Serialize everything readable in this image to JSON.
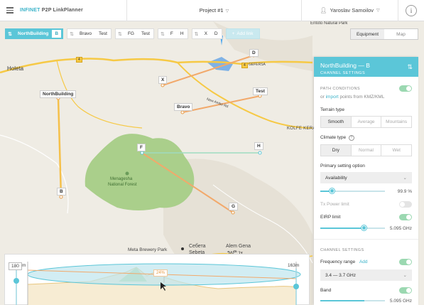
{
  "header": {
    "brand_part1": "INFINET",
    "brand_part2": "P2P LinkPlanner",
    "project": "Project #1",
    "user": "Yaroslav Samoilov",
    "info_label": "i"
  },
  "links": [
    {
      "a": "NorthBuilding",
      "b": "B",
      "active": true
    },
    {
      "a": "Bravo",
      "b": "Test"
    },
    {
      "a": "FG",
      "b": "Test"
    },
    {
      "a": "F",
      "b": "H"
    },
    {
      "a": "X",
      "b": "D"
    }
  ],
  "add_link": "Add link",
  "view_toggle": {
    "equipment": "Equipment",
    "map": "Map"
  },
  "map": {
    "sites": {
      "north": "NorthBuilding",
      "b": "B",
      "x": "X",
      "d": "D",
      "bravo": "Bravo",
      "test": "Test",
      "f": "F",
      "h": "H",
      "g": "G"
    },
    "places": {
      "holeta": "Holeta",
      "entoto": "Entoto Natural Park",
      "gefersa": "GEFERSA",
      "kolfe": "KOLFE KERA",
      "new_ambo": "New Ambo Rd",
      "menagesha1": "Menagesha",
      "menagesha2": "National Forest",
      "meta": "Meta Brewery Park",
      "alem": "Alem Gena",
      "alem2": "ዓለም ገና",
      "sebeta": "Sebeta",
      "sebeta2": "Себета"
    },
    "roads": {
      "r1": "4",
      "r2": "4"
    }
  },
  "panel": {
    "title": "NorthBuilding — B",
    "subtitle": "CHANNEL SETTINGS",
    "path_conditions": "PATH CONDITIONS",
    "or_text": "or",
    "import_link": "import",
    "import_rest": "points from KMZ/KML",
    "terrain_label": "Terrain type",
    "terrain_options": [
      "Smooth",
      "Average",
      "Mountains"
    ],
    "climate_label": "Climate type",
    "climate_help": "?",
    "climate_options": [
      "Dry",
      "Normal",
      "Wet"
    ],
    "primary_label": "Primary setting option",
    "primary_value": "Availability",
    "availability_value": "99.9 %",
    "availability_fraction": 0.18,
    "tx_power_label": "Tx Power limit",
    "eirp_label": "EIRP limit",
    "eirp_value": "5.095 GHz",
    "eirp_fraction": 0.68,
    "channel_settings": "CHANNEL SETTINGS",
    "freq_label": "Frequency range",
    "freq_add": "Add",
    "freq_value": "3.4 — 3.7 GHz",
    "band_label": "Band",
    "band_value": "5.095 GHz"
  },
  "profile": {
    "left_height": "180",
    "left_unit": "m",
    "right_height": "163m",
    "clearance": "24%"
  },
  "colors": {
    "accent": "#5bc6d8",
    "link_orange": "#f2a96b",
    "link_green": "#9fdcc0",
    "link_yellow": "#f5c04a",
    "forest": "#aacf8b"
  }
}
